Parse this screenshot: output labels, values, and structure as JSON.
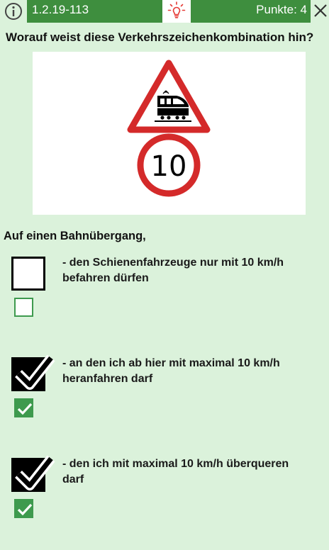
{
  "header": {
    "question_id": "1.2.19-113",
    "points_label": "Punkte: 4"
  },
  "question": {
    "text": "Worauf weist diese Verkehrszeichenkombination hin?",
    "lead": "Auf einen Bahnübergang,"
  },
  "sign": {
    "speed_limit": "10"
  },
  "answers": [
    {
      "text": "- den Schienenfahrzeuge nur mit 10 km/h befahren dürfen",
      "user_checked": false,
      "correct": false
    },
    {
      "text": "- an den ich ab hier mit maximal 10 km/h heranfahren darf",
      "user_checked": true,
      "correct": true
    },
    {
      "text": "- den ich mit maximal 10 km/h überqueren darf",
      "user_checked": true,
      "correct": true
    }
  ],
  "icons": {
    "info": "info-icon",
    "hint": "lightbulb-icon",
    "close": "close-icon"
  },
  "colors": {
    "background": "#dbf2db",
    "header_green": "#3e8e3e",
    "solution_green": "#3e9a4e",
    "hint_red": "#e53935",
    "sign_red": "#d42a2a"
  }
}
